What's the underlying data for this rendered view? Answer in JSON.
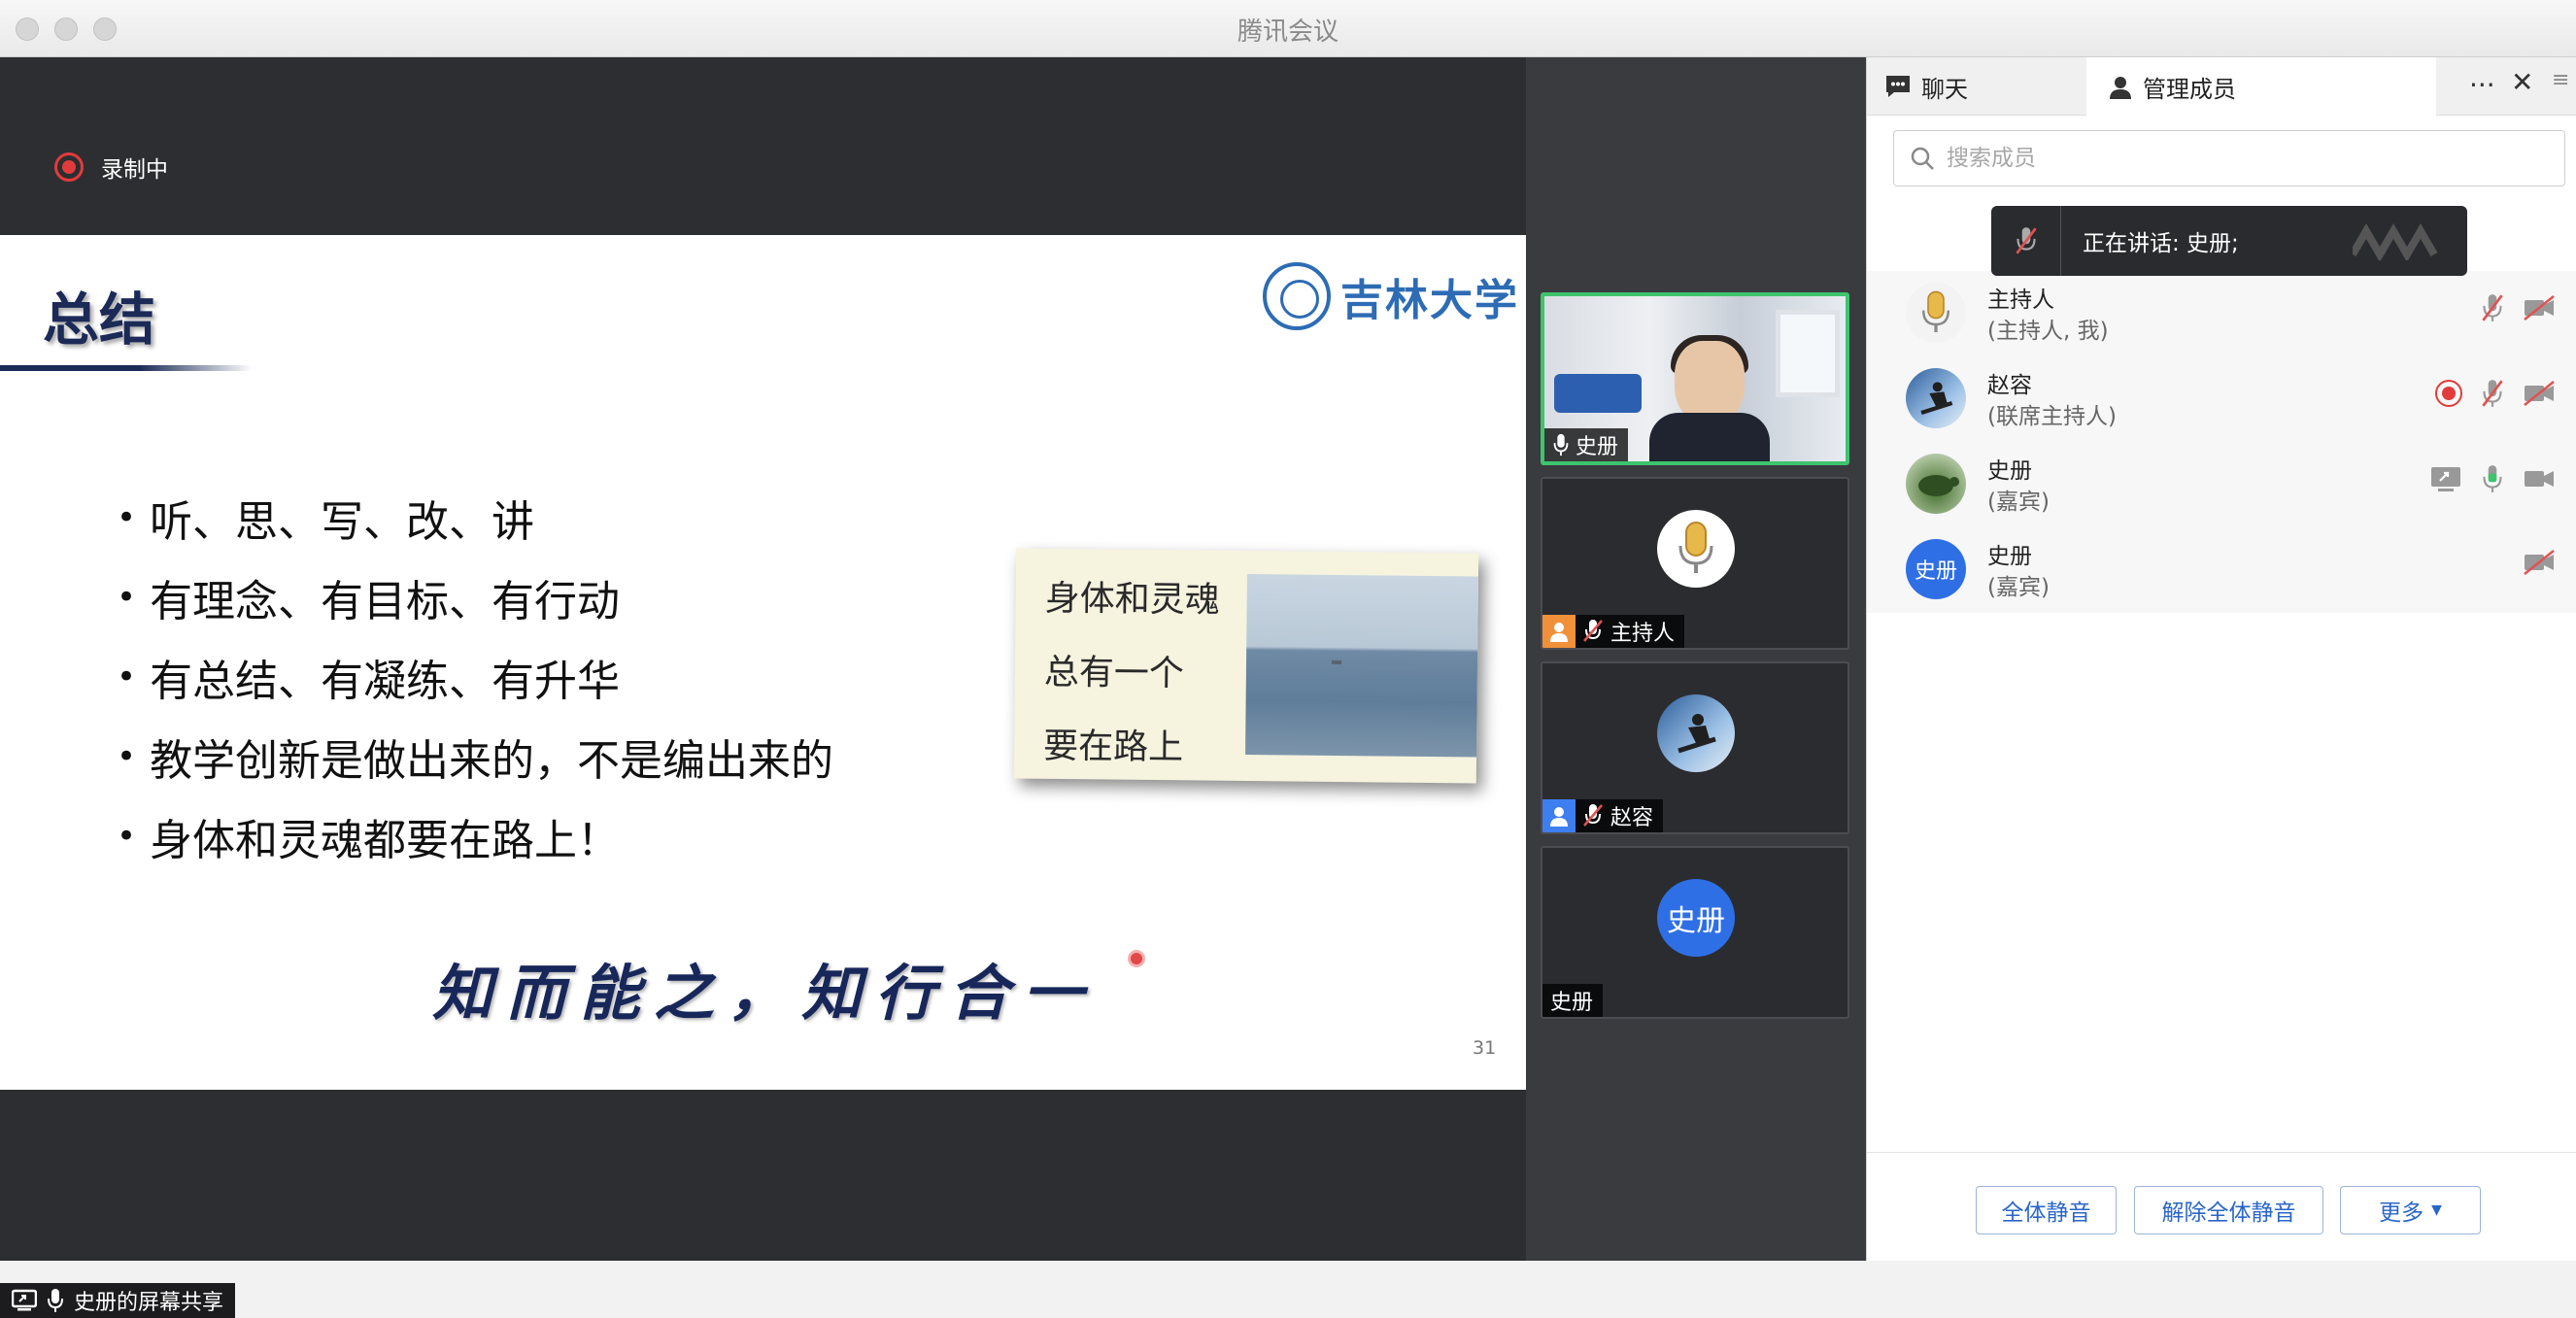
{
  "window": {
    "title": "腾讯会议"
  },
  "recording": {
    "label": "录制中"
  },
  "slide": {
    "title": "总结",
    "logo_text": "吉林大学",
    "bullets": [
      "听、思、写、改、讲",
      "有理念、有目标、有行动",
      "有总结、有凝练、有升华",
      "教学创新是做出来的，不是编出来的",
      "身体和灵魂都要在路上！"
    ],
    "poem": [
      "身体和灵魂",
      "总有一个",
      "要在路上"
    ],
    "motto": "知而能之，知行合一",
    "page_number": "31"
  },
  "share": {
    "label": "史册的屏幕共享"
  },
  "video_tiles": [
    {
      "name": "史册",
      "type": "camera",
      "mic": "on",
      "active": true
    },
    {
      "name": "主持人",
      "type": "mic-avatar",
      "mic": "muted",
      "badge": "orange"
    },
    {
      "name": "赵容",
      "type": "skier-avatar",
      "mic": "muted",
      "badge": "blue"
    },
    {
      "name": "史册",
      "type": "text-avatar",
      "avatar_text": "史册"
    }
  ],
  "panel": {
    "tabs": [
      {
        "label": "聊天",
        "icon": "chat-icon",
        "selected": false
      },
      {
        "label": "管理成员",
        "icon": "person-icon",
        "selected": true
      }
    ],
    "more_icon": "ellipsis-icon",
    "close_icon": "close-icon",
    "search": {
      "placeholder": "搜索成员",
      "value": ""
    },
    "speaking": "正在讲话: 史册;",
    "members": [
      {
        "name": "主持人",
        "role": "(主持人, 我)",
        "avatar": "mic",
        "recording": false,
        "mic": "muted",
        "video": "off",
        "sharing": false
      },
      {
        "name": "赵容",
        "role": "(联席主持人)",
        "avatar": "skier",
        "recording": true,
        "mic": "muted",
        "video": "off",
        "sharing": false
      },
      {
        "name": "史册",
        "role": "(嘉宾)",
        "avatar": "photo",
        "recording": false,
        "mic": "on",
        "video": "on",
        "sharing": true
      },
      {
        "name": "史册",
        "role": "(嘉宾)",
        "avatar": "text",
        "avatar_text": "史册",
        "recording": false,
        "mic": "none",
        "video": "off",
        "sharing": false
      }
    ],
    "footer": {
      "mute_all": "全体静音",
      "unmute_all": "解除全体静音",
      "more": "更多"
    }
  },
  "colors": {
    "accent_blue": "#2f6fe6",
    "speaking_green": "#3ec46d",
    "record_red": "#e23b3b",
    "muted_red": "#e05252"
  }
}
